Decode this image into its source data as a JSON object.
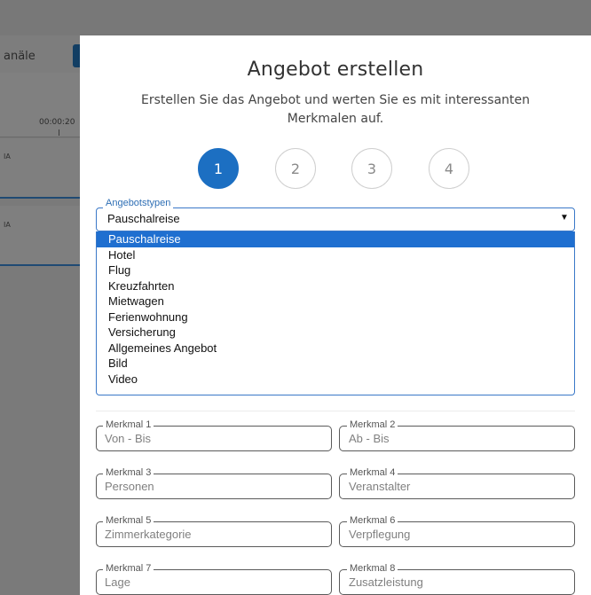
{
  "background": {
    "tab_label": "anäle",
    "timeline_time": "00:00:20",
    "track_labels": [
      "IA",
      "IA"
    ]
  },
  "modal": {
    "title": "Angebot erstellen",
    "subtitle": "Erstellen Sie das Angebot und werten Sie es mit interessanten Merkmalen auf."
  },
  "steps": [
    {
      "label": "1",
      "active": true
    },
    {
      "label": "2",
      "active": false
    },
    {
      "label": "3",
      "active": false
    },
    {
      "label": "4",
      "active": false
    }
  ],
  "offer_type": {
    "legend": "Angebotstypen",
    "selected": "Pauschalreise",
    "options": [
      "Pauschalreise",
      "Hotel",
      "Flug",
      "Kreuzfahrten",
      "Mietwagen",
      "Ferienwohnung",
      "Versicherung",
      "Allgemeines Angebot",
      "Bild",
      "Video"
    ]
  },
  "features": [
    {
      "label": "Merkmal 1",
      "placeholder": "Von - Bis"
    },
    {
      "label": "Merkmal 2",
      "placeholder": "Ab - Bis"
    },
    {
      "label": "Merkmal 3",
      "placeholder": "Personen"
    },
    {
      "label": "Merkmal 4",
      "placeholder": "Veranstalter"
    },
    {
      "label": "Merkmal 5",
      "placeholder": "Zimmerkategorie"
    },
    {
      "label": "Merkmal 6",
      "placeholder": "Verpflegung"
    },
    {
      "label": "Merkmal 7",
      "placeholder": "Lage"
    },
    {
      "label": "Merkmal 8",
      "placeholder": "Zusatzleistung"
    }
  ],
  "colors": {
    "accent": "#1c6fc2",
    "selected_option": "#1f6fd0",
    "overlay": "#7a7a7a"
  }
}
